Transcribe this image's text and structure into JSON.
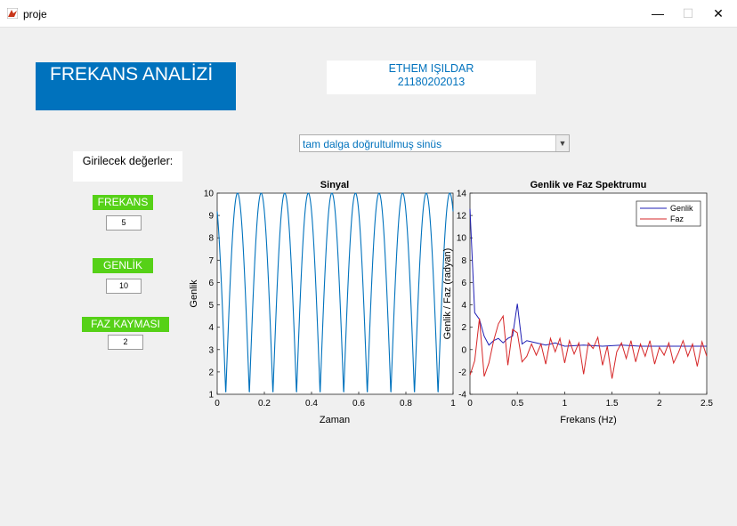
{
  "window": {
    "title": "proje",
    "minimize_glyph": "—",
    "maximize_glyph": "☐",
    "close_glyph": "✕"
  },
  "header": {
    "title": "FREKANS ANALİZİ"
  },
  "author": {
    "name": "ETHEM IŞILDAR",
    "id": "21180202013"
  },
  "signal_select": {
    "value": "tam dalga doğrultulmuş sinüs"
  },
  "inputs": {
    "label": "Girilecek değerler:",
    "frekans": {
      "label": "FREKANS",
      "value": "5"
    },
    "genlik": {
      "label": "GENLİK",
      "value": "10"
    },
    "faz": {
      "label": "FAZ KAYMASI",
      "value": "2"
    }
  },
  "colors": {
    "accent": "#0072bd",
    "green": "#56d117",
    "faz_line": "#d62728",
    "genlik_line": "#1f1fb4"
  },
  "chart_data": [
    {
      "type": "line",
      "title": "Sinyal",
      "xlabel": "Zaman",
      "ylabel": "Genlik",
      "xlim": [
        0,
        1
      ],
      "ylim": [
        1,
        10
      ],
      "xticks": [
        "0",
        "0.2",
        "0.4",
        "0.6",
        "0.8",
        "1"
      ],
      "yticks": [
        "1",
        "2",
        "3",
        "4",
        "5",
        "6",
        "7",
        "8",
        "9",
        "10"
      ],
      "series": [
        {
          "color": "#0072bd",
          "function": "1 + 9*|sin(2*pi*5*t + 2)|",
          "t_range": [
            0,
            1
          ]
        }
      ],
      "grid": false
    },
    {
      "type": "line",
      "title": "Genlik ve Faz Spektrumu",
      "xlabel": "Frekans (Hz)",
      "ylabel": "Genlik / Faz (radyan)",
      "xlim": [
        0,
        2.5
      ],
      "ylim": [
        -4,
        14
      ],
      "xticks": [
        "0",
        "0.5",
        "1",
        "1.5",
        "2",
        "2.5"
      ],
      "yticks": [
        "-4",
        "-2",
        "0",
        "2",
        "4",
        "6",
        "8",
        "10",
        "12",
        "14"
      ],
      "legend": "top-right",
      "grid": false,
      "series": [
        {
          "name": "Genlik",
          "color": "#1f1fb4",
          "x": [
            0,
            0.05,
            0.1,
            0.15,
            0.2,
            0.25,
            0.3,
            0.35,
            0.4,
            0.45,
            0.5,
            0.55,
            0.6,
            0.7,
            0.8,
            0.9,
            1.0,
            1.2,
            1.4,
            1.6,
            1.8,
            2.0,
            2.2,
            2.5
          ],
          "y": [
            12.6,
            3.3,
            2.7,
            1.2,
            0.4,
            0.8,
            1.0,
            0.6,
            1.0,
            1.2,
            4.1,
            0.5,
            0.8,
            0.6,
            0.4,
            0.6,
            0.3,
            0.4,
            0.3,
            0.4,
            0.3,
            0.3,
            0.3,
            0.3
          ]
        },
        {
          "name": "Faz",
          "color": "#d62728",
          "x": [
            0,
            0.05,
            0.1,
            0.15,
            0.2,
            0.25,
            0.3,
            0.35,
            0.4,
            0.45,
            0.5,
            0.55,
            0.6,
            0.65,
            0.7,
            0.75,
            0.8,
            0.85,
            0.9,
            0.95,
            1.0,
            1.05,
            1.1,
            1.15,
            1.2,
            1.25,
            1.3,
            1.35,
            1.4,
            1.45,
            1.5,
            1.55,
            1.6,
            1.65,
            1.7,
            1.75,
            1.8,
            1.85,
            1.9,
            1.95,
            2.0,
            2.05,
            2.1,
            2.15,
            2.2,
            2.25,
            2.3,
            2.35,
            2.4,
            2.45,
            2.5
          ],
          "y": [
            -2.3,
            -1.0,
            2.8,
            -2.4,
            -1.2,
            0.8,
            2.3,
            3.0,
            -1.4,
            1.8,
            1.5,
            -1.1,
            -0.6,
            0.5,
            -0.5,
            0.5,
            -1.3,
            1.0,
            -0.2,
            1.0,
            -1.2,
            0.8,
            -0.4,
            0.6,
            -2.2,
            0.6,
            0.1,
            1.1,
            -1.4,
            0.3,
            -2.6,
            -0.2,
            0.6,
            -0.8,
            0.8,
            -1.1,
            0.5,
            -0.6,
            0.8,
            -1.3,
            0.2,
            -0.5,
            0.6,
            -1.2,
            -0.3,
            0.8,
            -0.6,
            0.5,
            -1.5,
            0.7,
            -0.6
          ]
        }
      ]
    }
  ]
}
